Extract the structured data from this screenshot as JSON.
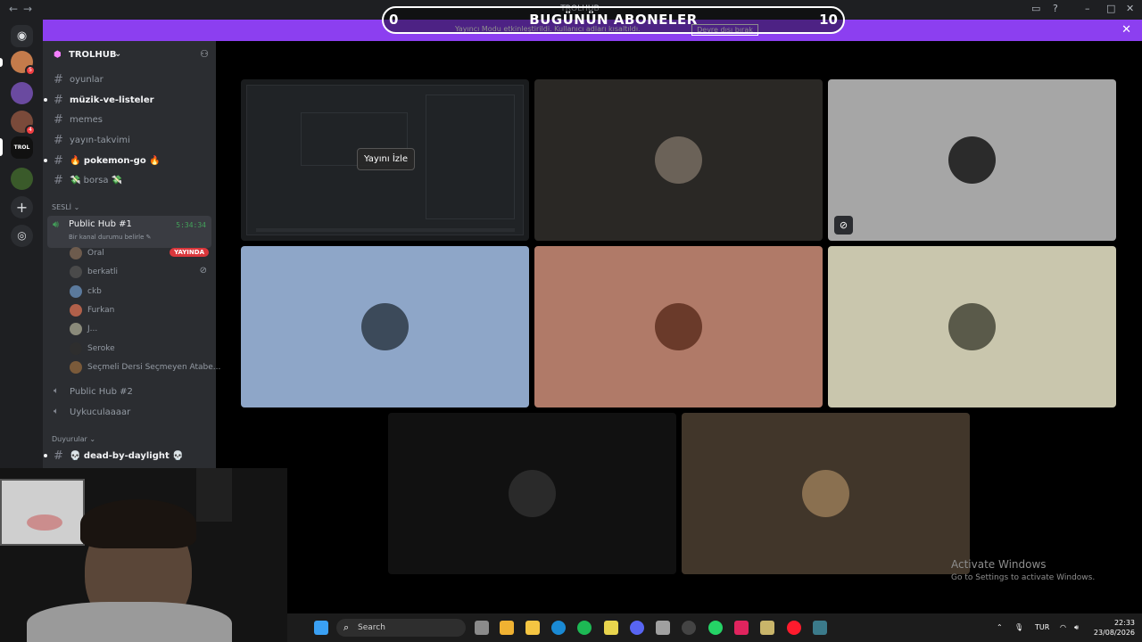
{
  "window": {
    "title": "TROLHUB",
    "back": "←",
    "forward": "→"
  },
  "overlay": {
    "left_count": "0",
    "title": "BUGÜNÜN ABONELER",
    "right_count": "10"
  },
  "banner": {
    "message": "Yayıncı Modu etkinleştirildi. Kullanıcı adları kısaltıldı.",
    "button": "Devre dışı bırak",
    "close": "✕"
  },
  "server": {
    "name": "TROLHUB"
  },
  "channels": [
    {
      "name": "oyunlar",
      "unread": false
    },
    {
      "name": "müzik-ve-listeler",
      "unread": true
    },
    {
      "name": "memes",
      "unread": false
    },
    {
      "name": "yayın-takvimi",
      "unread": false
    },
    {
      "name": "🔥 pokemon-go 🔥",
      "unread": true
    },
    {
      "name": "💸 borsa 💸",
      "unread": false
    }
  ],
  "voice_category": "SESLİ ⌄",
  "active_voice": {
    "name": "Public Hub #1",
    "time": "5:34:34",
    "status": "Bir kanal durumu belirle ✎"
  },
  "voice_users": [
    {
      "name": "Oral",
      "live_badge": "YAYINDA",
      "color": "#6d5b4d"
    },
    {
      "name": "berkatli",
      "muted": true,
      "color": "#4a4a4a"
    },
    {
      "name": "ckb",
      "color": "#5b7a9d"
    },
    {
      "name": "Furkan",
      "color": "#b0604a"
    },
    {
      "name": "J...",
      "color": "#8a8a7a"
    },
    {
      "name": "Seroke",
      "color": "#2e2e2e"
    },
    {
      "name": "Seçmeli Dersi Seçmeyen Atabe...",
      "color": "#7a5a3a"
    }
  ],
  "other_voice": [
    {
      "name": "Public Hub #2"
    },
    {
      "name": "Uykuculaaaar"
    }
  ],
  "announce_category": "Duyurular ⌄",
  "announce_channel": "💀 dead-by-daylight 💀",
  "stream_tile": {
    "button": "Yayını İzle"
  },
  "tiles": [
    {
      "bg": "#2a2825",
      "av": "#6b6258"
    },
    {
      "bg": "#a6a6a6",
      "av": "#2b2b2b",
      "muted": true
    },
    {
      "bg": "#8ea6c8",
      "av": "#3c4a5a"
    },
    {
      "bg": "#b07a68",
      "av": "#6a3a2a"
    },
    {
      "bg": "#c9c6ad",
      "av": "#5a5a4a"
    },
    {
      "bg": "#111111",
      "av": "#2a2a2a"
    },
    {
      "bg": "#41362a",
      "av": "#8a7050"
    }
  ],
  "watermark": {
    "line1": "Activate Windows",
    "line2": "Go to Settings to activate Windows."
  },
  "taskbar": {
    "search": "Search",
    "lang": "TUR",
    "time": "22:33",
    "date": "23/08/2026"
  },
  "colors": {
    "accent": "#8c3ff0",
    "live": "#da373c",
    "online": "#43a25a"
  }
}
